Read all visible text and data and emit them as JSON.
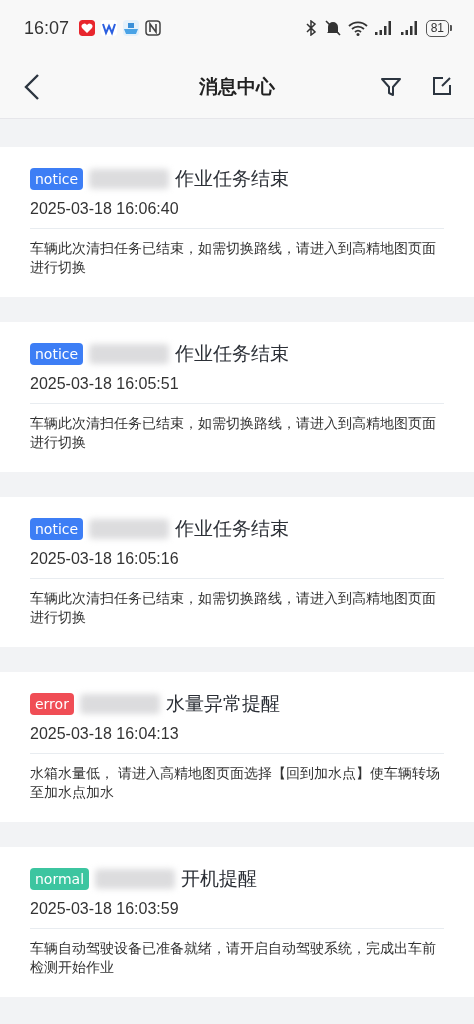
{
  "status_bar": {
    "time": "16:07",
    "battery": "81"
  },
  "header": {
    "title": "消息中心"
  },
  "messages": [
    {
      "tag": "notice",
      "color": "#3d7ef5",
      "title": "作业任务结束",
      "time": "2025-03-18 16:06:40",
      "body": "车辆此次清扫任务已结束，如需切换路线，请进入到高精地图页面进行切换"
    },
    {
      "tag": "notice",
      "color": "#3d7ef5",
      "title": "作业任务结束",
      "time": "2025-03-18 16:05:51",
      "body": "车辆此次清扫任务已结束，如需切换路线，请进入到高精地图页面进行切换"
    },
    {
      "tag": "notice",
      "color": "#3d7ef5",
      "title": "作业任务结束",
      "time": "2025-03-18 16:05:16",
      "body": "车辆此次清扫任务已结束，如需切换路线，请进入到高精地图页面进行切换"
    },
    {
      "tag": "error",
      "color": "#f04d55",
      "title": "水量异常提醒",
      "time": "2025-03-18 16:04:13",
      "body": "水箱水量低， 请进入高精地图页面选择【回到加水点】使车辆转场至加水点加水"
    },
    {
      "tag": "normal",
      "color": "#3cc5a0",
      "title": "开机提醒",
      "time": "2025-03-18 16:03:59",
      "body": "车辆自动驾驶设备已准备就绪，请开启自动驾驶系统，完成出车前检测开始作业"
    }
  ]
}
